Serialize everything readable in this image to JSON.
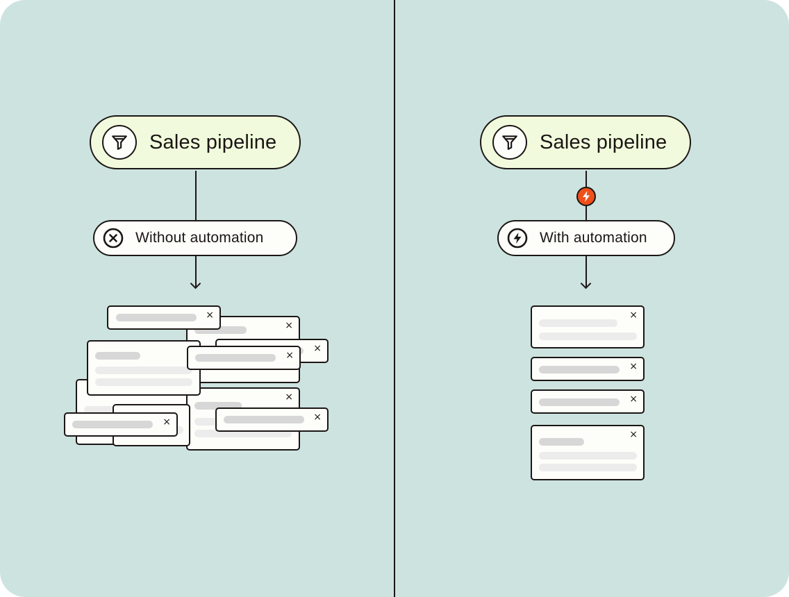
{
  "left": {
    "title": "Sales pipeline",
    "title_icon": "funnel-icon",
    "step_label": "Without automation",
    "step_icon": "x-circle-icon",
    "close_glyph": "×"
  },
  "right": {
    "title": "Sales pipeline",
    "title_icon": "funnel-icon",
    "trigger_icon": "lightning-bolt-icon",
    "step_label": "With automation",
    "step_icon": "lightning-bolt-circle-icon",
    "close_glyph": "×"
  },
  "colors": {
    "background": "#cde3e0",
    "pill_highlight": "#f1fadc",
    "card": "#fdfdf9",
    "stroke": "#1a1614",
    "accent": "#f04f1a"
  }
}
